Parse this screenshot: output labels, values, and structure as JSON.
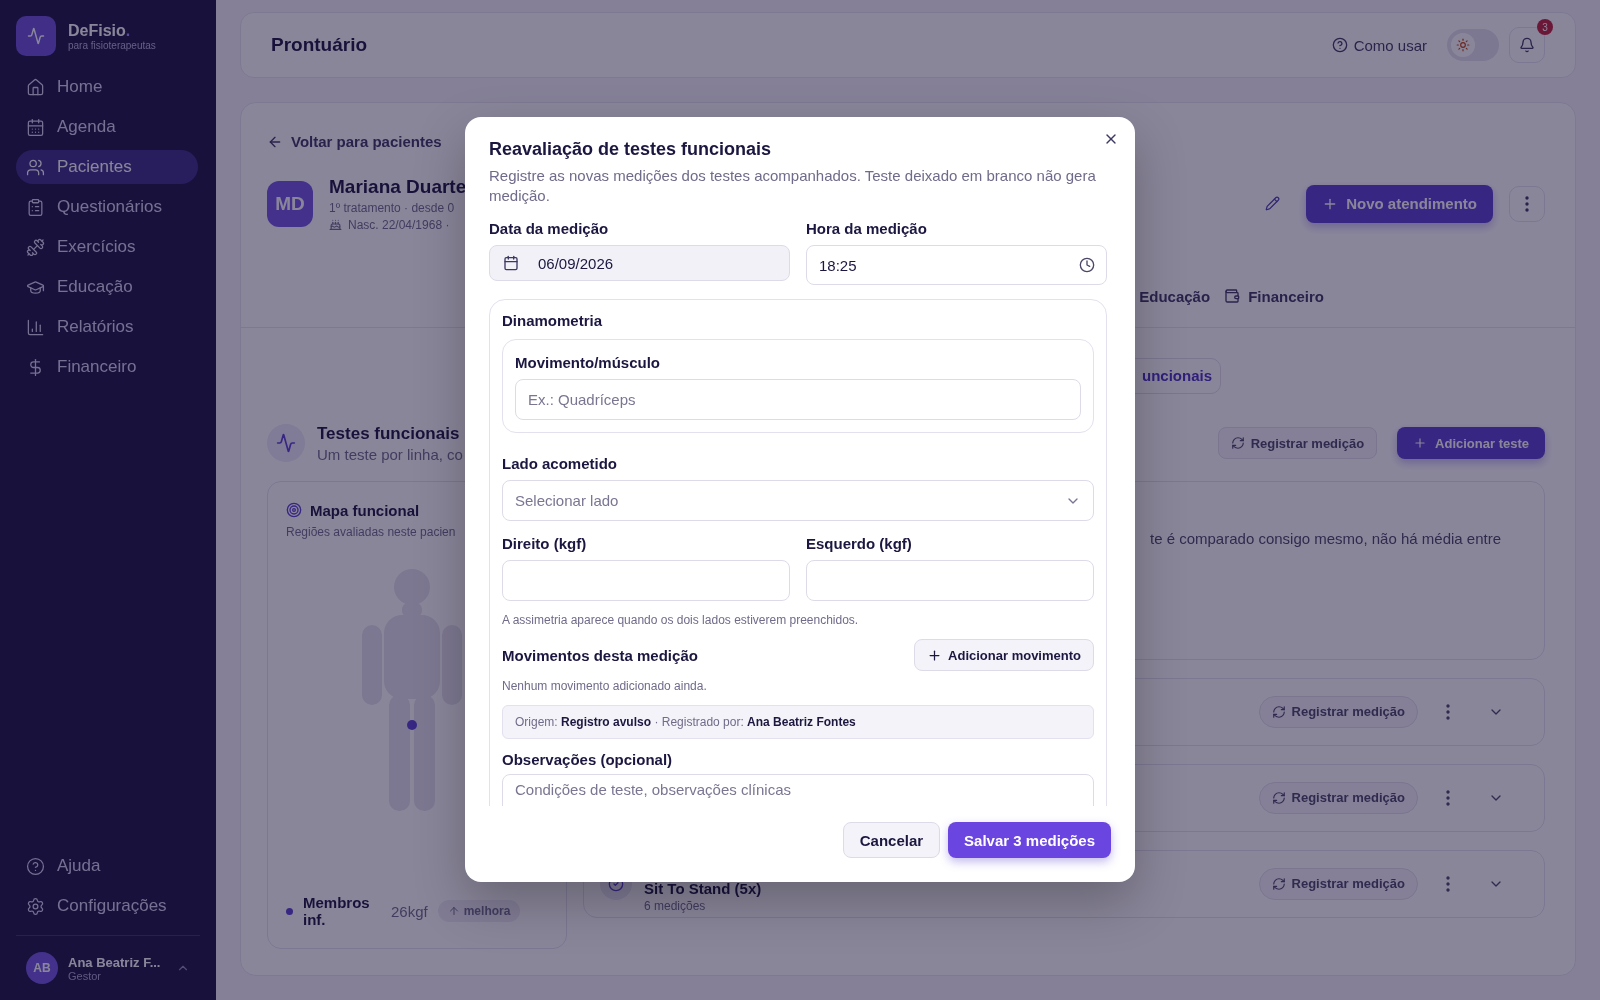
{
  "sidebar": {
    "brand": {
      "name": "DeFisio",
      "accent": ".",
      "tagline": "para fisioterapeutas"
    },
    "nav": [
      {
        "label": "Home",
        "selected": false
      },
      {
        "label": "Agenda",
        "selected": false
      },
      {
        "label": "Pacientes",
        "selected": true
      },
      {
        "label": "Questionários",
        "selected": false
      },
      {
        "label": "Exercícios",
        "selected": false
      },
      {
        "label": "Educação",
        "selected": false
      },
      {
        "label": "Relatórios",
        "selected": false
      },
      {
        "label": "Financeiro",
        "selected": false
      }
    ],
    "footer_nav": [
      {
        "label": "Ajuda"
      },
      {
        "label": "Configurações"
      }
    ],
    "user": {
      "initials": "AB",
      "name": "Ana Beatriz F...",
      "role": "Gestor"
    }
  },
  "header": {
    "title": "Prontuário",
    "help": "Como usar",
    "dark_mode": false,
    "notifications": "3"
  },
  "patient": {
    "back": "Voltar para pacientes",
    "initials": "MD",
    "name": "Mariana Duarte",
    "info": "1º tratamento · desde 0",
    "birth": "Nasc. 22/04/1968 ·",
    "new_button": "Novo atendimento"
  },
  "tabs": [
    {
      "label": "Educação",
      "selected": false
    },
    {
      "label": "Financeiro",
      "selected": false
    }
  ],
  "subtabs": [
    {
      "label": "uncionais",
      "selected": true
    }
  ],
  "section": {
    "title": "Testes funcionais",
    "subtitle": "Um teste por linha, co",
    "register": "Registrar medição",
    "add": "Adicionar teste"
  },
  "map": {
    "title": "Mapa funcional",
    "subtitle": "Regiões avaliadas neste pacien",
    "legend": [
      {
        "label": "Membros inf.",
        "value": "26kgf",
        "trend": "melhora"
      }
    ]
  },
  "summary": "te é comparado consigo mesmo, não há média entre",
  "tests": [
    {
      "action": "Registrar medição"
    },
    {
      "action": "Registrar medição"
    },
    {
      "name": "Sit To Stand (5x)",
      "count": "6 medições",
      "action": "Registrar medição"
    }
  ],
  "modal": {
    "title": "Reavaliação de testes funcionais",
    "description": "Registre as novas medições dos testes acompanhados. Teste deixado em branco não gera medição.",
    "date": {
      "label": "Data da medição",
      "value": "06/09/2026"
    },
    "time": {
      "label": "Hora da medição",
      "value": "18:25"
    },
    "test": {
      "title": "Dinamometria",
      "movement": {
        "label": "Movimento/músculo",
        "placeholder": "Ex.: Quadríceps"
      },
      "side": {
        "label": "Lado acometido",
        "placeholder": "Selecionar lado"
      },
      "right": {
        "label": "Direito (kgf)"
      },
      "left": {
        "label": "Esquerdo (kgf)"
      },
      "hint": "A assimetria aparece quando os dois lados estiverem preenchidos.",
      "movements_title": "Movimentos desta medição",
      "add_movement": "Adicionar movimento",
      "empty": "Nenhum movimento adicionado ainda.",
      "origin": "Origem: **Registro avulso** · Registrado por: **Ana Beatriz Fontes**",
      "notes": {
        "label": "Observações (opcional)",
        "placeholder": "Condições de teste, observações clínicas"
      }
    },
    "cancel": "Cancelar",
    "save": "Salvar 3 medições"
  }
}
